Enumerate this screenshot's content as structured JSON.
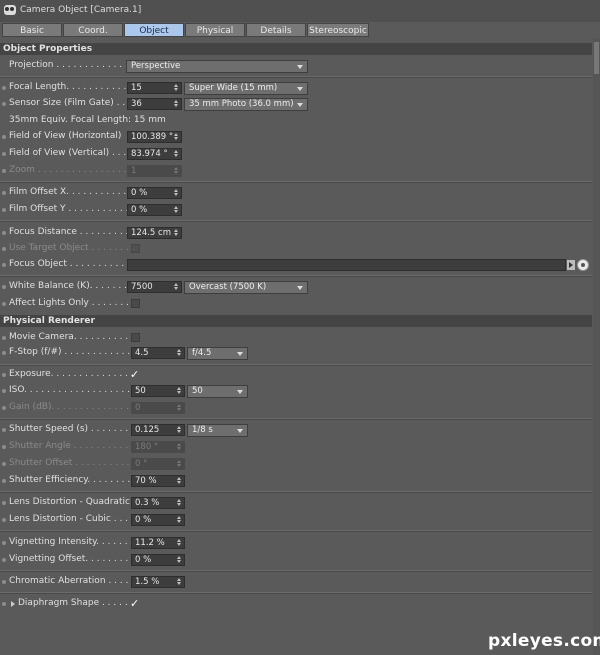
{
  "window": {
    "title": "Camera Object [Camera.1]"
  },
  "tabs": [
    "Basic",
    "Coord.",
    "Object",
    "Physical",
    "Details",
    "Stereoscopic"
  ],
  "active_tab": "Object",
  "sections": {
    "object": "Object Properties",
    "physical": "Physical Renderer"
  },
  "fields": {
    "projection": {
      "label": "Projection . . . . . . . . . . . . . .",
      "value": "Perspective"
    },
    "focal_length": {
      "label": "Focal Length. . . . . . . . . . . .",
      "value": "15",
      "preset": "Super Wide (15 mm)"
    },
    "sensor_size": {
      "label": "Sensor Size (Film Gate) . . .",
      "value": "36",
      "preset": "35 mm Photo (36.0 mm)"
    },
    "equiv_focal": {
      "label": "35mm Equiv. Focal Length: 15 mm"
    },
    "fov_h": {
      "label": "Field of View (Horizontal)",
      "value": "100.389 °"
    },
    "fov_v": {
      "label": "Field of View (Vertical) . . .",
      "value": "83.974 °"
    },
    "zoom": {
      "label": "Zoom . . . . . . . . . . . . . . . . . .",
      "value": "1"
    },
    "film_offset_x": {
      "label": "Film Offset X. . . . . . . . . . . .",
      "value": "0 %"
    },
    "film_offset_y": {
      "label": "Film Offset Y . . . . . . . . . . .",
      "value": "0 %"
    },
    "focus_distance": {
      "label": "Focus Distance . . . . . . . . . .",
      "value": "124.5 cm"
    },
    "use_target": {
      "label": "Use Target Object . . . . . . . ."
    },
    "focus_object": {
      "label": "Focus Object . . . . . . . . . . . ."
    },
    "white_balance": {
      "label": "White Balance (K). . . . . . . .",
      "value": "7500",
      "preset": "Overcast (7500 K)"
    },
    "affect_lights": {
      "label": "Affect Lights Only . . . . . . . ."
    },
    "movie_camera": {
      "label": "Movie Camera. . . . . . . . . . ."
    },
    "fstop": {
      "label": "F-Stop (f/#) . . . . . . . . . . . . .",
      "value": "4.5",
      "preset": "f/4.5"
    },
    "exposure": {
      "label": "Exposure. . . . . . . . . . . . . . ."
    },
    "iso": {
      "label": "ISO. . . . . . . . . . . . . . . . . . .",
      "value": "50",
      "preset": "50"
    },
    "gain": {
      "label": "Gain (dB). . . . . . . . . . . . . . .",
      "value": "0"
    },
    "shutter_speed": {
      "label": "Shutter Speed (s) . . . . . . . .",
      "value": "0.125",
      "preset": "1/8 s"
    },
    "shutter_angle": {
      "label": "Shutter Angle . . . . . . . . . . .",
      "value": "180 °"
    },
    "shutter_offset": {
      "label": "Shutter Offset . . . . . . . . . .",
      "value": "0 °"
    },
    "shutter_eff": {
      "label": "Shutter Efficiency. . . . . . . . .",
      "value": "70 %"
    },
    "lens_quad": {
      "label": "Lens Distortion - Quadratic",
      "value": "0.3 %"
    },
    "lens_cubic": {
      "label": "Lens Distortion - Cubic . . . .",
      "value": "0 %"
    },
    "vign_int": {
      "label": "Vignetting Intensity. . . . . . .",
      "value": "11.2 %"
    },
    "vign_off": {
      "label": "Vignetting Offset. . . . . . . . .",
      "value": "0 %"
    },
    "chromatic": {
      "label": "Chromatic Aberration . . . . .",
      "value": "1.5 %"
    },
    "diaphragm": {
      "label": "Diaphragm Shape . . . . ."
    }
  },
  "checked": {
    "exposure": true,
    "diaphragm": true,
    "movie_camera": false,
    "use_target": false,
    "affect_lights": false
  },
  "check_glyph": "✓",
  "watermark": "pxleyes.com",
  "colors": {
    "active_tab": "#aac8ee",
    "panel_bg": "#5a5a5a",
    "field_bg": "#3d3d3d",
    "section_bg": "#444444"
  }
}
